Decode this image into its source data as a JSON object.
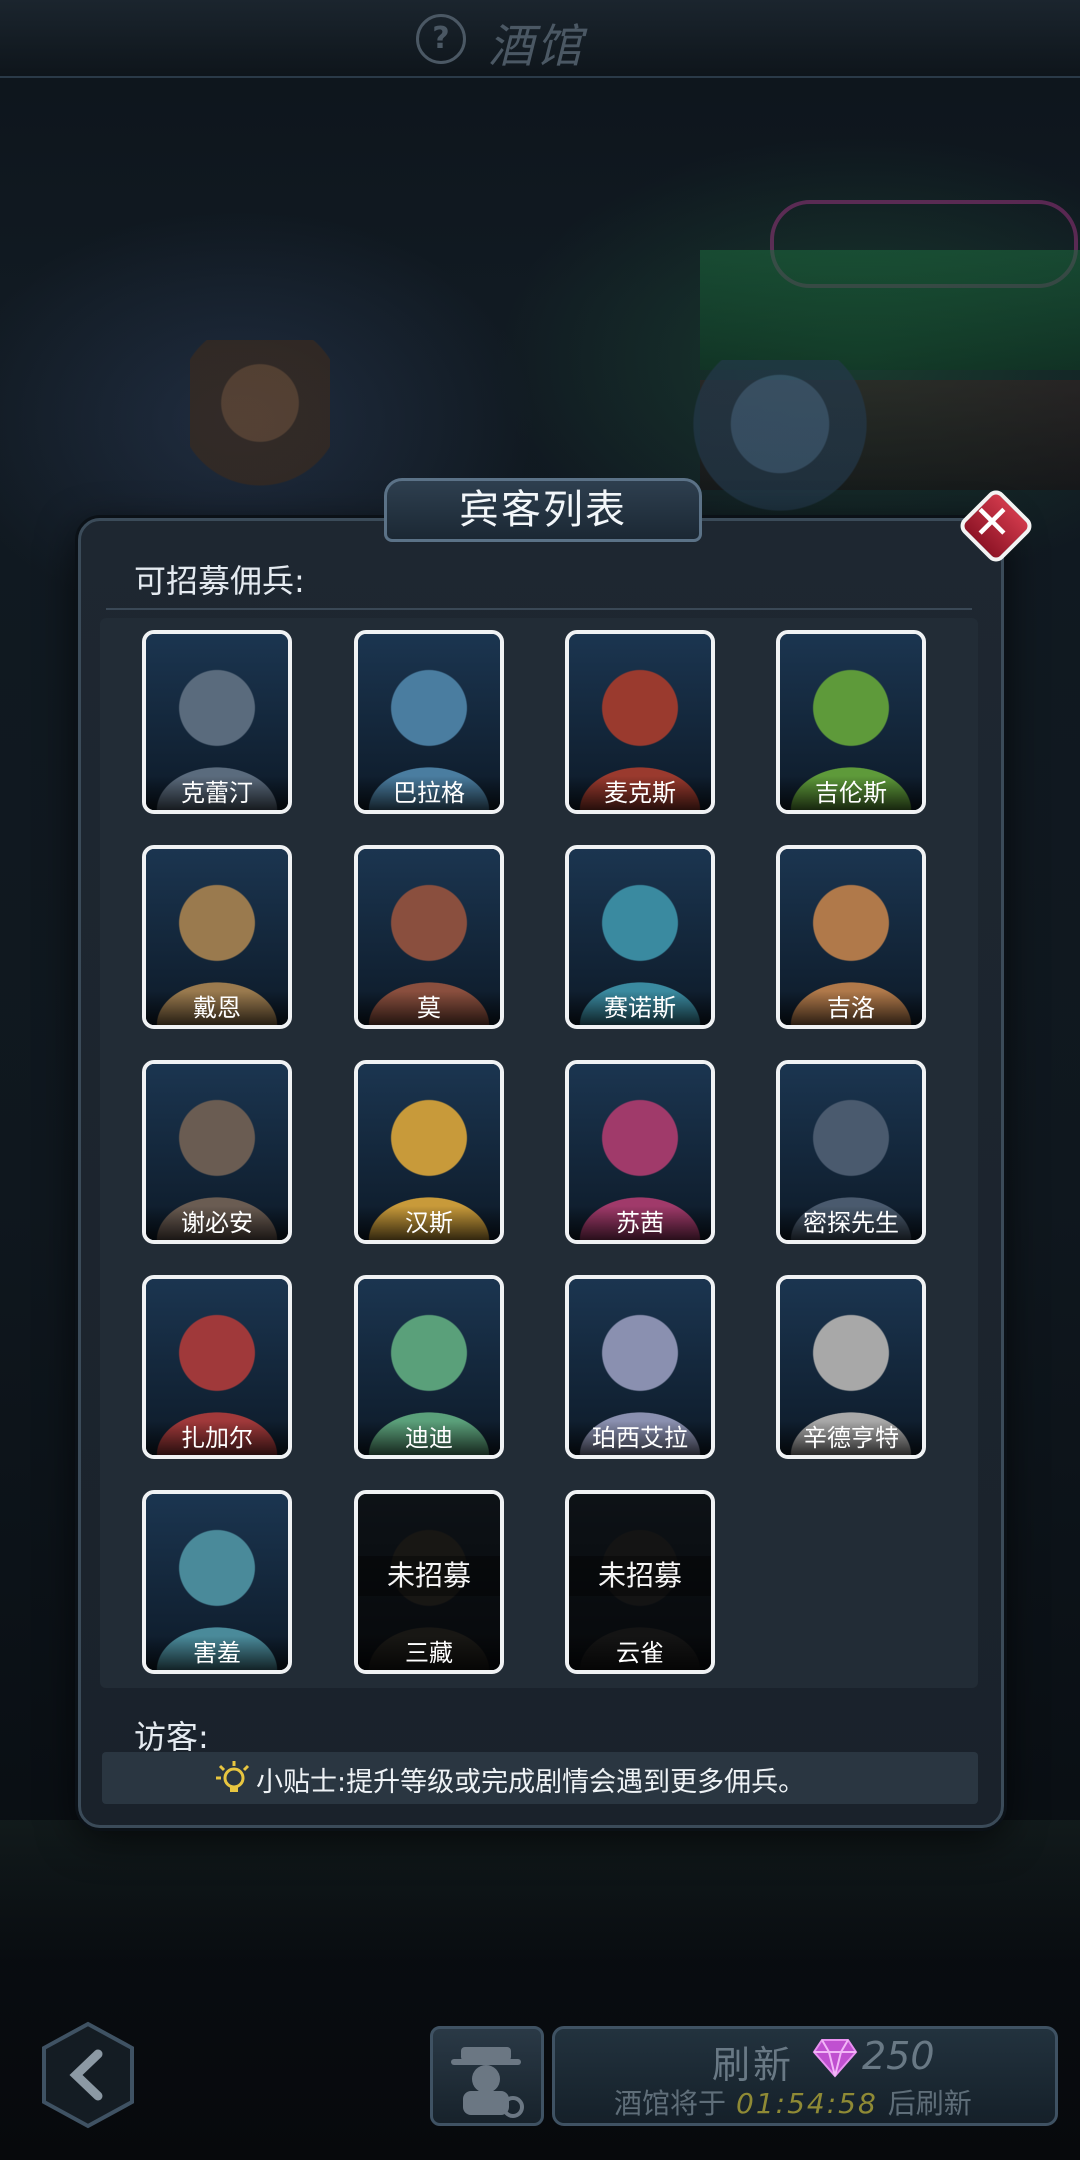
{
  "header": {
    "title": "酒馆",
    "help_icon": "question-icon"
  },
  "dialog": {
    "title": "宾客列表",
    "recruitable_label": "可招募佣兵:",
    "visitors_label": "访客:",
    "tip": "小贴士:提升等级或完成剧情会遇到更多佣兵。",
    "close_icon": "close-icon"
  },
  "mercenaries": [
    {
      "name": "克蕾汀",
      "color": "#5a6b7d",
      "recruited": true
    },
    {
      "name": "巴拉格",
      "color": "#4a7da0",
      "recruited": true
    },
    {
      "name": "麦克斯",
      "color": "#9a3a2e",
      "recruited": true
    },
    {
      "name": "吉伦斯",
      "color": "#5e9a3a",
      "recruited": true
    },
    {
      "name": "戴恩",
      "color": "#9a7a4e",
      "recruited": true
    },
    {
      "name": "莫",
      "color": "#8a4f3e",
      "recruited": true
    },
    {
      "name": "赛诺斯",
      "color": "#3a8aa0",
      "recruited": true
    },
    {
      "name": "吉洛",
      "color": "#b0794a",
      "recruited": true
    },
    {
      "name": "谢必安",
      "color": "#6a5c52",
      "recruited": true
    },
    {
      "name": "汉斯",
      "color": "#c89a3a",
      "recruited": true
    },
    {
      "name": "苏茜",
      "color": "#a03a6a",
      "recruited": true
    },
    {
      "name": "密探先生",
      "color": "#4a5a6e",
      "recruited": true
    },
    {
      "name": "扎加尔",
      "color": "#a0393a",
      "recruited": true
    },
    {
      "name": "迪迪",
      "color": "#5aa07a",
      "recruited": true
    },
    {
      "name": "珀西艾拉",
      "color": "#8a90b0",
      "recruited": true
    },
    {
      "name": "辛德亨特",
      "color": "#a8a8a8",
      "recruited": true
    },
    {
      "name": "害羞",
      "color": "#4a8a9a",
      "recruited": true
    },
    {
      "name": "三藏",
      "color": "#4a4030",
      "recruited": false,
      "status": "未招募"
    },
    {
      "name": "云雀",
      "color": "#3a3a3a",
      "recruited": false,
      "status": "未招募"
    }
  ],
  "footer": {
    "back_icon": "back-arrow-icon",
    "hero_icon": "spy-icon",
    "refresh_label": "刷新",
    "gem_icon": "gem-icon",
    "refresh_cost": "250",
    "timer_prefix": "酒馆将于",
    "timer_value": "01:54:58",
    "timer_suffix": "后刷新"
  },
  "colors": {
    "close_red": "#c2283b",
    "gem": "#c050d0",
    "timer": "#8f8a35"
  }
}
